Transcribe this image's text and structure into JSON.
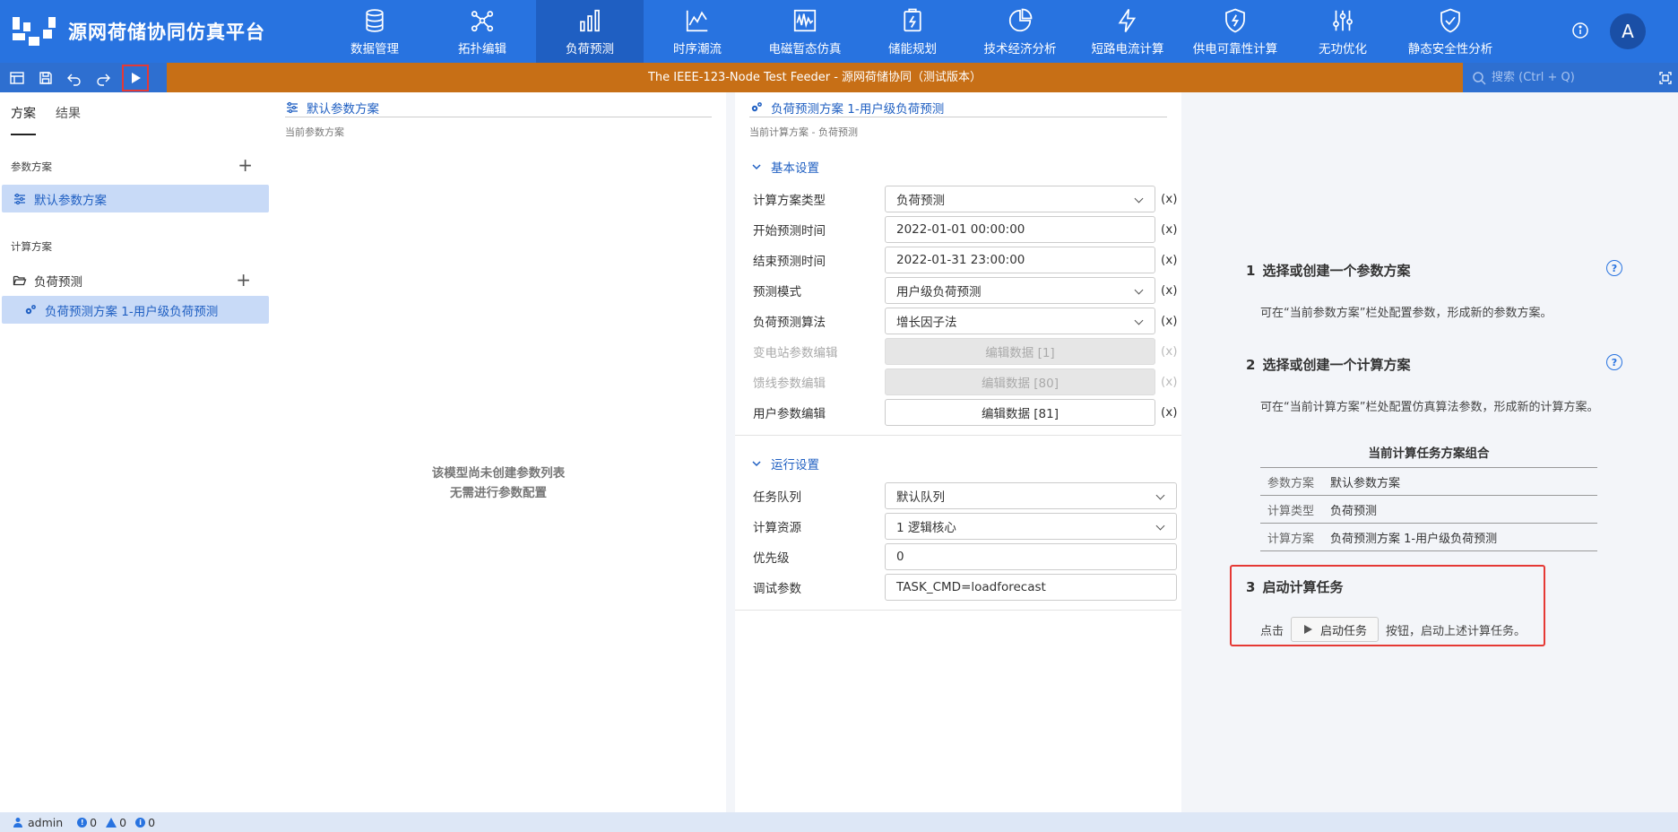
{
  "app": {
    "title": "源网荷储协同仿真平台",
    "avatar_letter": "A"
  },
  "nav": [
    {
      "label": "数据管理",
      "icon": "database-icon"
    },
    {
      "label": "拓扑编辑",
      "icon": "topology-icon"
    },
    {
      "label": "负荷预测",
      "icon": "bar-chart-icon",
      "active": true
    },
    {
      "label": "时序潮流",
      "icon": "line-chart-icon"
    },
    {
      "label": "电磁暂态仿真",
      "icon": "waveform-icon"
    },
    {
      "label": "储能规划",
      "icon": "battery-icon"
    },
    {
      "label": "技术经济分析",
      "icon": "pie-chart-icon"
    },
    {
      "label": "短路电流计算",
      "icon": "lightning-icon"
    },
    {
      "label": "供电可靠性计算",
      "icon": "shield-bolt-icon"
    },
    {
      "label": "无功优化",
      "icon": "sliders-icon"
    },
    {
      "label": "静态安全性分析",
      "icon": "shield-check-icon"
    }
  ],
  "toolbar": {
    "title": "The IEEE-123-Node Test Feeder - 源网荷储协同（测试版本）",
    "search_placeholder": "搜索 (Ctrl + Q)"
  },
  "left": {
    "tabs": [
      "方案",
      "结果"
    ],
    "param_section": "参数方案",
    "param_item": "默认参数方案",
    "calc_section": "计算方案",
    "folder": "负荷预测",
    "calc_item": "负荷预测方案 1-用户级负荷预测"
  },
  "param_panel": {
    "title": "默认参数方案",
    "subtitle": "当前参数方案",
    "empty_line1": "该模型尚未创建参数列表",
    "empty_line2": "无需进行参数配置"
  },
  "calc_panel": {
    "title": "负荷预测方案 1-用户级负荷预测",
    "subtitle": "当前计算方案 - 负荷预测",
    "basic_group": "基本设置",
    "run_group": "运行设置",
    "xmark": "(x)",
    "basic_fields": [
      {
        "label": "计算方案类型",
        "value": "负荷预测"
      },
      {
        "label": "开始预测时间",
        "value": "2022-01-01 00:00:00"
      },
      {
        "label": "结束预测时间",
        "value": "2022-01-31 23:00:00"
      },
      {
        "label": "预测模式",
        "value": "用户级负荷预测"
      },
      {
        "label": "负荷预测算法",
        "value": "增长因子法"
      },
      {
        "label": "变电站参数编辑",
        "value": "编辑数据 [1]"
      },
      {
        "label": "馈线参数编辑",
        "value": "编辑数据 [80]"
      },
      {
        "label": "用户参数编辑",
        "value": "编辑数据 [81]"
      }
    ],
    "run_fields": [
      {
        "label": "任务队列",
        "value": "默认队列"
      },
      {
        "label": "计算资源",
        "value": "1 逻辑核心"
      },
      {
        "label": "优先级",
        "value": "0"
      },
      {
        "label": "调试参数",
        "value": "TASK_CMD=loadforecast"
      }
    ]
  },
  "guide": {
    "step1_num": "1",
    "step1_title": "选择或创建一个参数方案",
    "step1_desc": "可在“当前参数方案”栏处配置参数，形成新的参数方案。",
    "step2_num": "2",
    "step2_title": "选择或创建一个计算方案",
    "step2_desc": "可在“当前计算方案”栏处配置仿真算法参数，形成新的计算方案。",
    "combo_title": "当前计算任务方案组合",
    "combo": [
      {
        "k": "参数方案",
        "v": "默认参数方案"
      },
      {
        "k": "计算类型",
        "v": "负荷预测"
      },
      {
        "k": "计算方案",
        "v": "负荷预测方案 1-用户级负荷预测"
      }
    ],
    "step3_num": "3",
    "step3_title": "启动计算任务",
    "step3_prefix": "点击",
    "step3_button": "启动任务",
    "step3_suffix": "按钮，启动上述计算任务。"
  },
  "status": {
    "user": "admin",
    "errors": "0",
    "warnings": "0",
    "infos": "0"
  }
}
